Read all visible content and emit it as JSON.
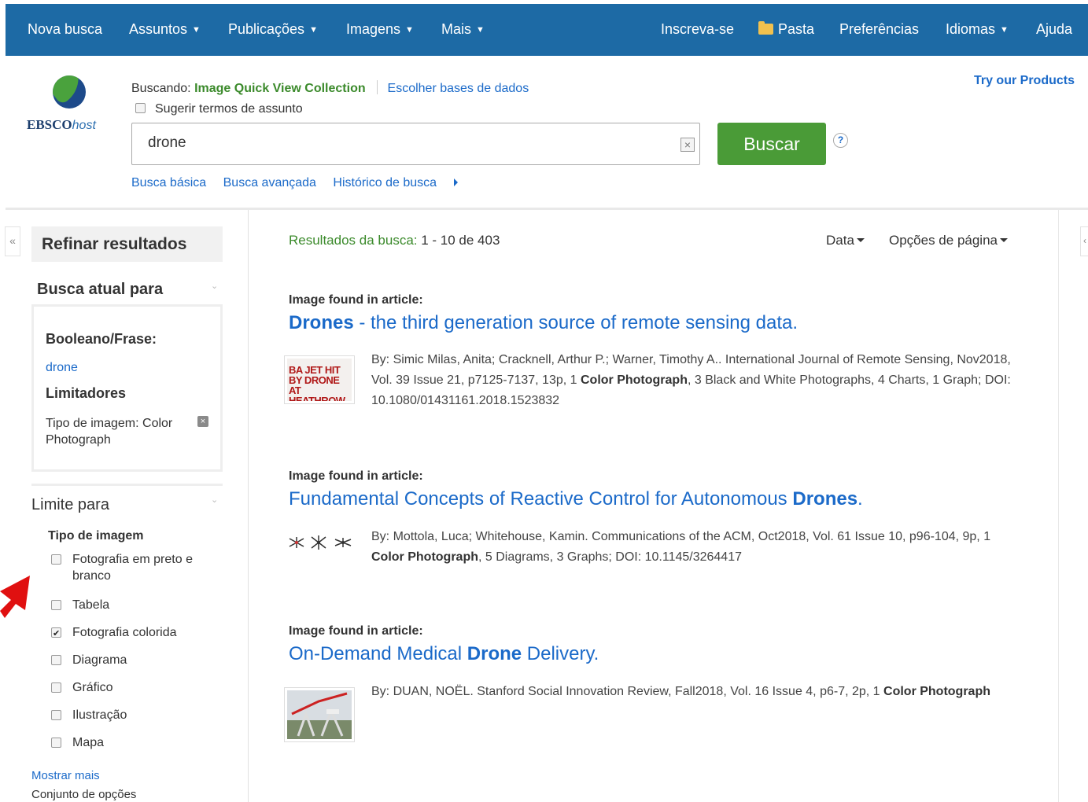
{
  "nav": {
    "left": [
      "Nova busca",
      "Assuntos",
      "Publicações",
      "Imagens",
      "Mais"
    ],
    "right": [
      "Inscreva-se",
      "Pasta",
      "Preferências",
      "Idiomas",
      "Ajuda"
    ]
  },
  "logo": {
    "brand": "EBSCO",
    "suffix": "host"
  },
  "search": {
    "searching_label": "Buscando:",
    "database": "Image Quick View Collection",
    "choose_db": "Escolher bases de dados",
    "suggest_label": "Sugerir termos de assunto",
    "query": "drone",
    "button": "Buscar",
    "help": "?",
    "links": [
      "Busca básica",
      "Busca avançada",
      "Histórico de busca"
    ]
  },
  "try_products": "Try our Products",
  "sidebar": {
    "collapse": "«",
    "refine_title": "Refinar resultados",
    "current_search_title": "Busca atual para",
    "boolean_label": "Booleano/Frase:",
    "query": "drone",
    "limiters_label": "Limitadores",
    "limiter_value": "Tipo de imagem: Color Photograph",
    "limit_title": "Limite para",
    "image_type_label": "Tipo de imagem",
    "image_types": [
      {
        "label": "Fotografia em preto e branco",
        "checked": false
      },
      {
        "label": "Tabela",
        "checked": false
      },
      {
        "label": "Fotografia colorida",
        "checked": true
      },
      {
        "label": "Diagrama",
        "checked": false
      },
      {
        "label": "Gráfico",
        "checked": false
      },
      {
        "label": "Ilustração",
        "checked": false
      },
      {
        "label": "Mapa",
        "checked": false
      }
    ],
    "show_more": "Mostrar mais",
    "option_set": "Conjunto de opções"
  },
  "results": {
    "count_label": "Resultados da busca:",
    "count_value": "1 - 10 de 403",
    "sort_label": "Data",
    "page_options": "Opções de página",
    "items": [
      {
        "found": "Image found in article:",
        "title_bold": "Drones",
        "title_rest": " - the third generation source of remote sensing data.",
        "desc_pre": "By: Simic Milas, Anita; Cracknell, Arthur P.; Warner, Timothy A.. International Journal of Remote Sensing, Nov2018, Vol. 39 Issue 21, p7125-7137, 13p, 1 ",
        "desc_bold": "Color Photograph",
        "desc_post": ", 3 Black and White Photographs, 4 Charts, 1 Graph; DOI: 10.1080/01431161.2018.1523832",
        "thumb_text": [
          "BA JET HIT",
          "BY DRONE",
          "AT HEATHROW"
        ]
      },
      {
        "found": "Image found in article:",
        "title_pre": "Fundamental Concepts of Reactive Control for Autonomous ",
        "title_bold": "Drones",
        "title_post": ".",
        "desc_pre": "By: Mottola, Luca; Whitehouse, Kamin. Communications of the ACM, Oct2018, Vol. 61 Issue 10, p96-104, 9p, 1 ",
        "desc_bold": "Color Photograph",
        "desc_post": ", 5 Diagrams, 3 Graphs; DOI: 10.1145/3264417"
      },
      {
        "found": "Image found in article:",
        "title_pre": "On-Demand Medical ",
        "title_bold": "Drone",
        "title_post": " Delivery.",
        "desc_pre": "By: DUAN, NOËL. Stanford Social Innovation Review, Fall2018, Vol. 16 Issue 4, p6-7, 2p, 1 ",
        "desc_bold": "Color Photograph",
        "desc_post": ""
      }
    ]
  },
  "colors": {
    "nav_bg": "#1d6aa5",
    "link": "#1b6ac9",
    "accent_green": "#4a9b37",
    "arrow": "#e01010"
  }
}
